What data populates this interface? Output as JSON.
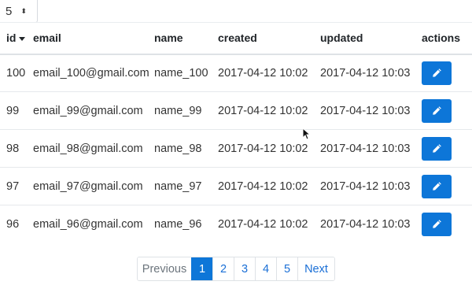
{
  "page_size": {
    "value": "5"
  },
  "columns": [
    "id",
    "email",
    "name",
    "created",
    "updated",
    "actions"
  ],
  "rows": [
    {
      "id": "100",
      "email": "email_100@gmail.com",
      "name": "name_100",
      "created": "2017-04-12 10:02",
      "updated": "2017-04-12 10:03"
    },
    {
      "id": "99",
      "email": "email_99@gmail.com",
      "name": "name_99",
      "created": "2017-04-12 10:02",
      "updated": "2017-04-12 10:03"
    },
    {
      "id": "98",
      "email": "email_98@gmail.com",
      "name": "name_98",
      "created": "2017-04-12 10:02",
      "updated": "2017-04-12 10:03"
    },
    {
      "id": "97",
      "email": "email_97@gmail.com",
      "name": "name_97",
      "created": "2017-04-12 10:02",
      "updated": "2017-04-12 10:03"
    },
    {
      "id": "96",
      "email": "email_96@gmail.com",
      "name": "name_96",
      "created": "2017-04-12 10:02",
      "updated": "2017-04-12 10:03"
    }
  ],
  "row_action_icon": "pencil-icon",
  "pagination": {
    "previous": "Previous",
    "pages": [
      "1",
      "2",
      "3",
      "4",
      "5"
    ],
    "active_page": "1",
    "next": "Next"
  },
  "colors": {
    "primary": "#0d76d8",
    "link": "#1a6fd6"
  }
}
